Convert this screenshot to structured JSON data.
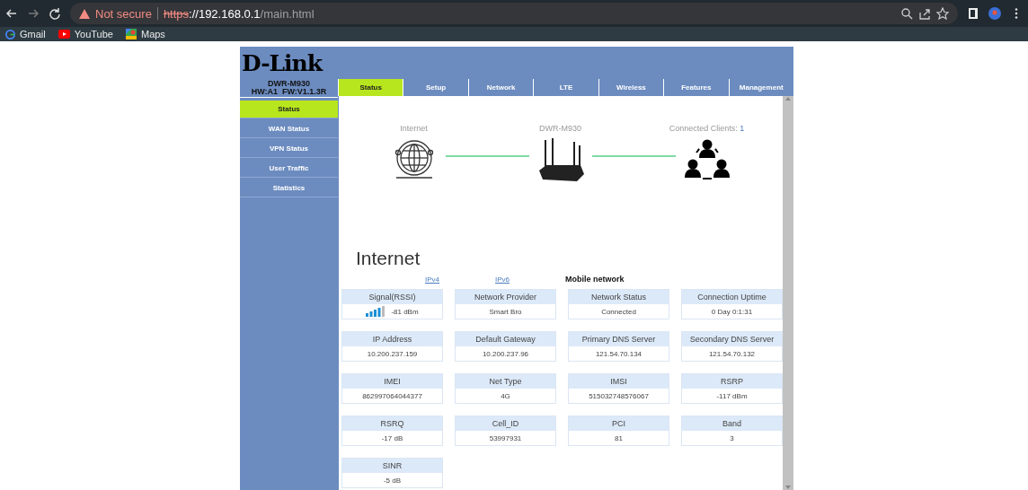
{
  "browser": {
    "security": "Not secure",
    "url_scheme": "https",
    "url_host": "://192.168.0.1",
    "url_path": "/main.html",
    "bookmarks": [
      {
        "label": "Gmail",
        "kind": "google"
      },
      {
        "label": "YouTube",
        "kind": "youtube"
      },
      {
        "label": "Maps",
        "kind": "maps"
      }
    ]
  },
  "brand": {
    "logo": "D-Link",
    "model": "DWR-M930",
    "hardware": "HW:A1",
    "firmware": "FW:V1.1.3R"
  },
  "tabs": [
    {
      "label": "Status",
      "selected": true
    },
    {
      "label": "Setup",
      "selected": false
    },
    {
      "label": "Network",
      "selected": false
    },
    {
      "label": "LTE",
      "selected": false
    },
    {
      "label": "Wireless",
      "selected": false
    },
    {
      "label": "Features",
      "selected": false
    },
    {
      "label": "Management",
      "selected": false
    }
  ],
  "sidebar": {
    "items": [
      {
        "label": "Status",
        "selected": true
      },
      {
        "label": "WAN Status",
        "selected": false
      },
      {
        "label": "VPN Status",
        "selected": false
      },
      {
        "label": "User Traffic",
        "selected": false
      },
      {
        "label": "Statistics",
        "selected": false
      }
    ]
  },
  "diagram": {
    "nodes": [
      {
        "label": "Internet",
        "kind": "globe"
      },
      {
        "label": "DWR-M930",
        "kind": "router"
      },
      {
        "label": "Connected Clients:",
        "count": "1",
        "kind": "clients"
      }
    ]
  },
  "section": {
    "title": "Internet",
    "subtabs": [
      {
        "label": "IPv4",
        "selected": false
      },
      {
        "label": "IPv6",
        "selected": false
      },
      {
        "label": "Mobile network",
        "selected": true
      }
    ],
    "fields": [
      {
        "label": "Signal(RSSI)",
        "value": "-81 dBm",
        "kind": "signal"
      },
      {
        "label": "Network Provider",
        "value": "Smart Bro",
        "kind": "text"
      },
      {
        "label": "Network Status",
        "value": "Connected",
        "kind": "text"
      },
      {
        "label": "Connection Uptime",
        "value": "0 Day 0:1:31",
        "kind": "text"
      },
      {
        "label": "IP Address",
        "value": "10.200.237.159",
        "kind": "text"
      },
      {
        "label": "Default Gateway",
        "value": "10.200.237.96",
        "kind": "text"
      },
      {
        "label": "Primary DNS Server",
        "value": "121.54.70.134",
        "kind": "text"
      },
      {
        "label": "Secondary DNS Server",
        "value": "121.54.70.132",
        "kind": "text"
      },
      {
        "label": "IMEI",
        "value": "862997064044377",
        "kind": "text"
      },
      {
        "label": "Net Type",
        "value": "4G",
        "kind": "text"
      },
      {
        "label": "IMSI",
        "value": "515032748576067",
        "kind": "text"
      },
      {
        "label": "RSRP",
        "value": "-117 dBm",
        "kind": "text"
      },
      {
        "label": "RSRQ",
        "value": "-17 dB",
        "kind": "text"
      },
      {
        "label": "Cell_ID",
        "value": "53997931",
        "kind": "text"
      },
      {
        "label": "PCI",
        "value": "81",
        "kind": "text"
      },
      {
        "label": "Band",
        "value": "3",
        "kind": "text"
      },
      {
        "label": "SINR",
        "value": "-5 dB",
        "kind": "text"
      }
    ]
  }
}
